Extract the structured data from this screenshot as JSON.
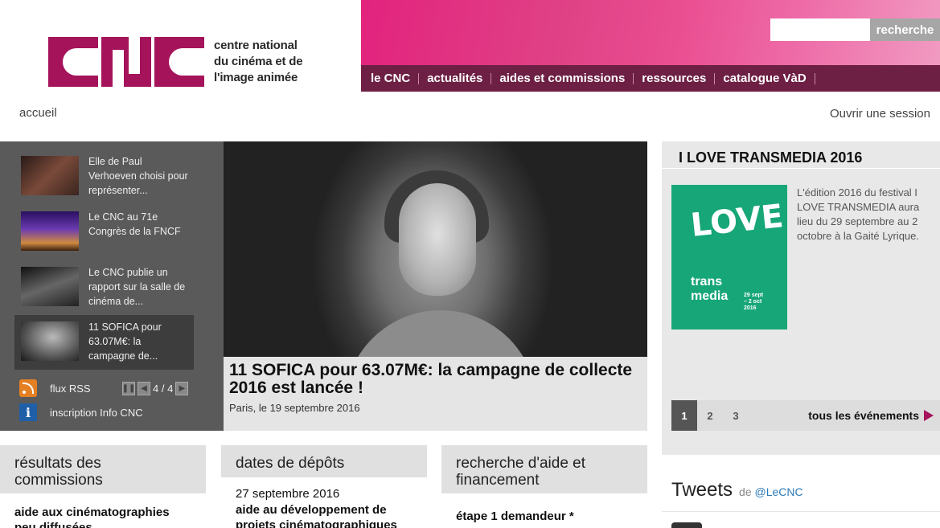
{
  "header": {
    "logo_letters": "CNC",
    "logo_lines": [
      "centre national",
      "du cinéma et de",
      "l'image animée"
    ],
    "search_placeholder": "",
    "search_button": "recherche",
    "nav": [
      "le CNC",
      "actualités",
      "aides et commissions",
      "ressources",
      "catalogue VàD"
    ]
  },
  "breadcrumb": "accueil",
  "login": "Ouvrir une session",
  "news": {
    "items": [
      {
        "text": "Elle de Paul Verhoeven choisi pour représenter..."
      },
      {
        "text": "Le CNC au 71e Congrès de la FNCF"
      },
      {
        "text": "Le CNC publie un rapport sur la salle de cinéma de..."
      },
      {
        "text": "11 SOFICA pour 63.07M€: la campagne de..."
      }
    ],
    "rss_label": "flux RSS",
    "pager": "4 / 4",
    "info_label": "inscription Info CNC"
  },
  "hero": {
    "title": "11 SOFICA pour 63.07M€: la campagne de collecte 2016 est lancée !",
    "date": "Paris, le 19 septembre 2016"
  },
  "event": {
    "title": "I LOVE TRANSMEDIA 2016",
    "image_text": {
      "love": "LOVE",
      "trans": "trans",
      "media": "media",
      "date1": "29 sept",
      "date2": "– 2 oct",
      "year": "2016"
    },
    "text": "L'édition 2016 du festival I LOVE TRANSMEDIA aura lieu du 29 septembre au 2 octobre à la Gaité Lyrique.",
    "pages": [
      "1",
      "2",
      "3"
    ],
    "all_label": "tous les événements"
  },
  "boxes": {
    "commissions": {
      "title": "résultats des commissions",
      "text": "aide aux cinématographies peu diffusées"
    },
    "depots": {
      "title": "dates de dépôts",
      "date": "27 septembre 2016",
      "text": "aide au développement de projets cinématographiques"
    },
    "recherche": {
      "title": "recherche d'aide et financement",
      "text": "étape 1 demandeur *"
    }
  },
  "tweets": {
    "title": "Tweets",
    "prefix": "de",
    "handle": "@LeCNC"
  },
  "colors": {
    "brand": "#a5135b",
    "nav_bg": "#6d1f44",
    "event_green": "#17a678"
  }
}
